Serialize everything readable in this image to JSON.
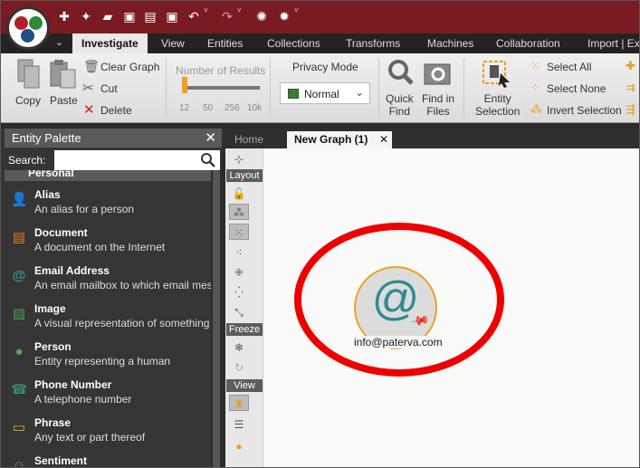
{
  "ribbon_tabs": [
    "Investigate",
    "View",
    "Entities",
    "Collections",
    "Transforms",
    "Machines",
    "Collaboration",
    "Import | Ex"
  ],
  "ribbon": {
    "copy": "Copy",
    "paste": "Paste",
    "clear_graph": "Clear Graph",
    "cut": "Cut",
    "delete": "Delete",
    "results_title": "Number of Results",
    "results_ticks": [
      "12",
      "50",
      "256",
      "10k"
    ],
    "results_selected_index": 0,
    "privacy_title": "Privacy Mode",
    "privacy_value": "Normal",
    "quick_find": [
      "Quick",
      "Find"
    ],
    "find_in_files": [
      "Find in",
      "Files"
    ],
    "entity_selection": [
      "Entity",
      "Selection"
    ],
    "select_all": "Select All",
    "select_none": "Select None",
    "invert_selection": "Invert Selection"
  },
  "palette": {
    "title": "Entity Palette",
    "search_label": "Search:",
    "search_value": "",
    "group": "Personal",
    "entities": [
      {
        "name": "Alias",
        "desc": "An alias for a person",
        "icon": "alias-icon",
        "color": "#6aaa4a"
      },
      {
        "name": "Document",
        "desc": "A document on the Internet",
        "icon": "document-icon",
        "color": "#e07b20"
      },
      {
        "name": "Email Address",
        "desc": "An email mailbox to which email mes",
        "icon": "at-icon",
        "color": "#2f9aa0"
      },
      {
        "name": "Image",
        "desc": "A visual representation of something",
        "icon": "image-icon",
        "color": "#4a9a4a"
      },
      {
        "name": "Person",
        "desc": "Entity representing a human",
        "icon": "person-icon",
        "color": "#5aa05a"
      },
      {
        "name": "Phone Number",
        "desc": "A telephone number",
        "icon": "phone-icon",
        "color": "#3a8a6a"
      },
      {
        "name": "Phrase",
        "desc": "Any text or part thereof",
        "icon": "speech-bubble-icon",
        "color": "#e8b020"
      },
      {
        "name": "Sentiment",
        "desc": "",
        "icon": "sentiment-icon",
        "color": "#888"
      }
    ]
  },
  "doc_tabs": {
    "home": "Home",
    "graph": "New Graph (1)"
  },
  "layout_panel": {
    "layout": "Layout",
    "freeze": "Freeze",
    "view": "View"
  },
  "graph": {
    "node_label": "info@paterva.com",
    "node_icon": "at-icon",
    "node_glyph": "@",
    "highlight_color": "#e00000"
  }
}
